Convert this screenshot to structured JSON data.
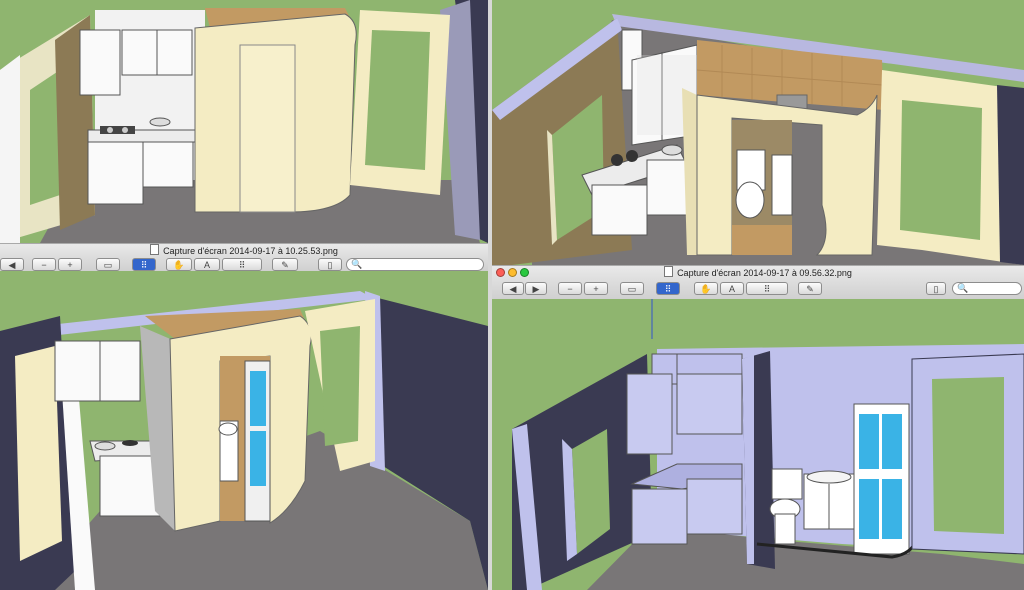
{
  "windows": {
    "top_right": {
      "title": "Capture d'écran 2014-09-17 à 09.56.32.png"
    },
    "bottom_left_strip": {
      "title": "Capture d'écran 2014-09-17 à 10.25.53.png"
    }
  },
  "toolbar": {
    "prev_symbol": "◀",
    "next_symbol": "▶",
    "zoom_out_symbol": "−",
    "zoom_in_symbol": "+",
    "slideshow_symbol": "▭",
    "move_symbol": "✋",
    "text_symbol": "A",
    "select_symbol": "⠿",
    "annotate_symbol": "✎",
    "sidebar_symbol": "▯",
    "search_symbol": "🔍"
  },
  "colors": {
    "sketch_background": "#8fb56f",
    "wall_cream": "#f4ecc3",
    "wall_lavender": "#bfc1ec",
    "floor_grey": "#797677",
    "tile_brown": "#c29a63",
    "cabinet_white": "#ffffff",
    "glass_blue": "#3ab3e6",
    "traffic_red": "#fc5f57",
    "traffic_yellow": "#fdbc2e",
    "traffic_green": "#29c840"
  }
}
